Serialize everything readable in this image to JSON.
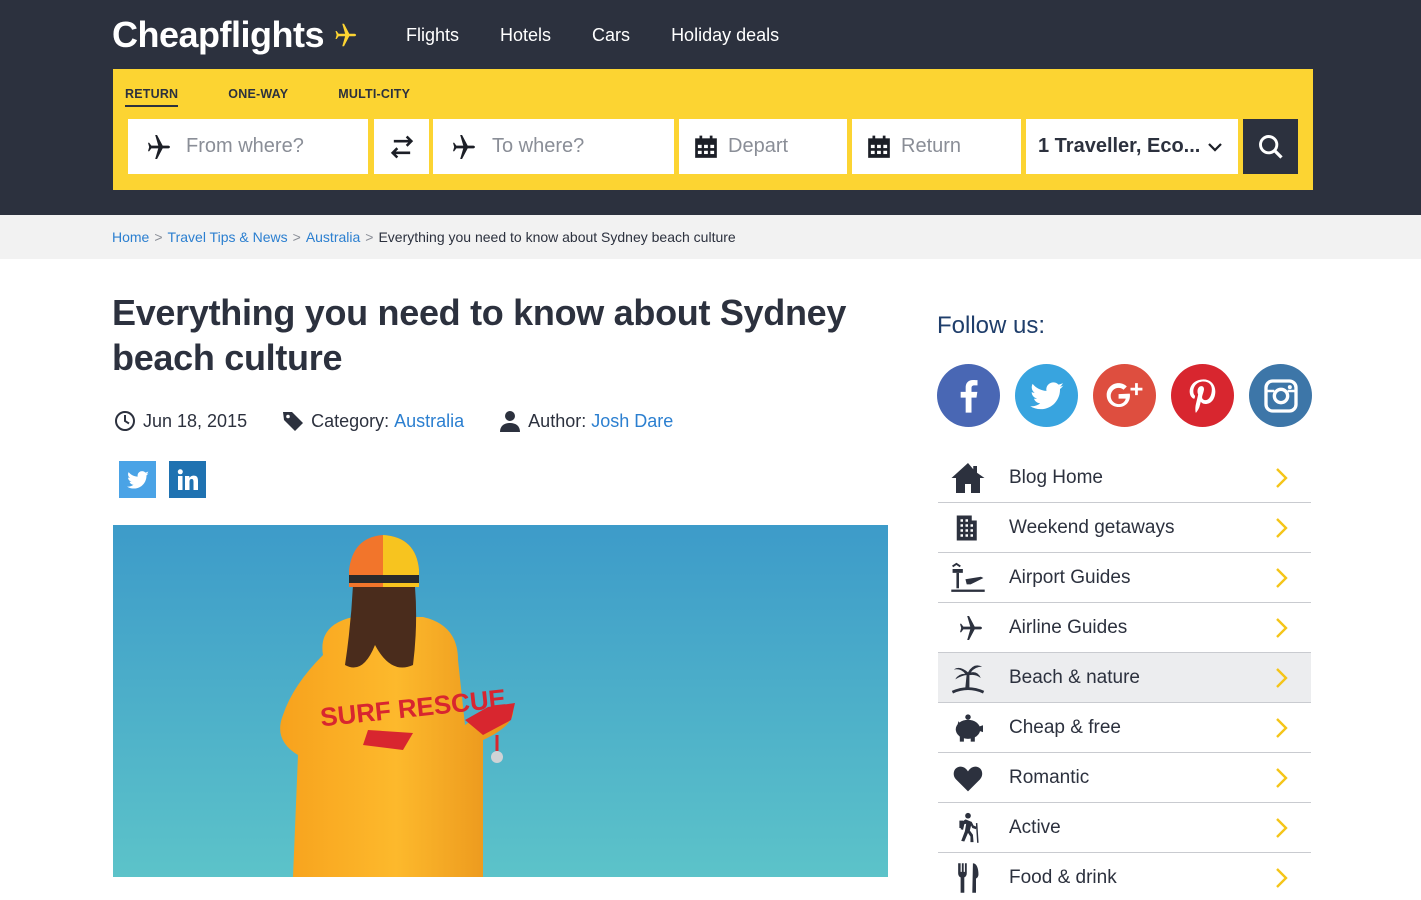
{
  "header": {
    "logo": "Cheapflights",
    "nav": [
      "Flights",
      "Hotels",
      "Cars",
      "Holiday deals"
    ]
  },
  "search": {
    "trip_types": [
      "RETURN",
      "ONE-WAY",
      "MULTI-CITY"
    ],
    "active_trip_type": "RETURN",
    "from_placeholder": "From where?",
    "to_placeholder": "To where?",
    "depart_placeholder": "Depart",
    "return_placeholder": "Return",
    "travellers_value": "1 Traveller, Eco...",
    "icons": {
      "from": "plane-icon",
      "swap": "swap-arrows-icon",
      "to": "plane-icon",
      "depart": "calendar-icon",
      "return": "calendar-icon",
      "travellers": "chevron-down-icon",
      "search": "search-icon"
    }
  },
  "breadcrumb": {
    "items": [
      "Home",
      "Travel Tips & News",
      "Australia"
    ],
    "separator": ">",
    "current": "Everything you need to know about Sydney beach culture"
  },
  "article": {
    "title": "Everything you need to know about Sydney beach culture",
    "date": "Jun 18, 2015",
    "category_label": "Category:",
    "category": "Australia",
    "author_label": "Author:",
    "author": "Josh Dare",
    "share": [
      "twitter-icon",
      "linkedin-icon"
    ],
    "hero_image": {
      "description_icon": "lifeguard-photo",
      "jacket_text": "SURF RESCUE"
    }
  },
  "sidebar": {
    "follow_label": "Follow us:",
    "socials": [
      "facebook-icon",
      "twitter-icon",
      "google-plus-icon",
      "pinterest-icon",
      "instagram-icon"
    ],
    "categories": [
      {
        "label": "Blog Home",
        "icon": "house-icon"
      },
      {
        "label": "Weekend getaways",
        "icon": "building-icon"
      },
      {
        "label": "Airport Guides",
        "icon": "airport-icon"
      },
      {
        "label": "Airline Guides",
        "icon": "plane-icon"
      },
      {
        "label": "Beach & nature",
        "icon": "palm-tree-icon"
      },
      {
        "label": "Cheap & free",
        "icon": "piggy-bank-icon"
      },
      {
        "label": "Romantic",
        "icon": "heart-icon"
      },
      {
        "label": "Active",
        "icon": "hiker-icon"
      },
      {
        "label": "Food & drink",
        "icon": "cutlery-icon"
      }
    ],
    "highlighted": "Beach & nature"
  },
  "colors": {
    "header_bg": "#2c313e",
    "search_bg": "#fcd432",
    "link": "#2b7fd0",
    "accent_yellow": "#f5c518",
    "follow_text": "#1f3e6b"
  }
}
